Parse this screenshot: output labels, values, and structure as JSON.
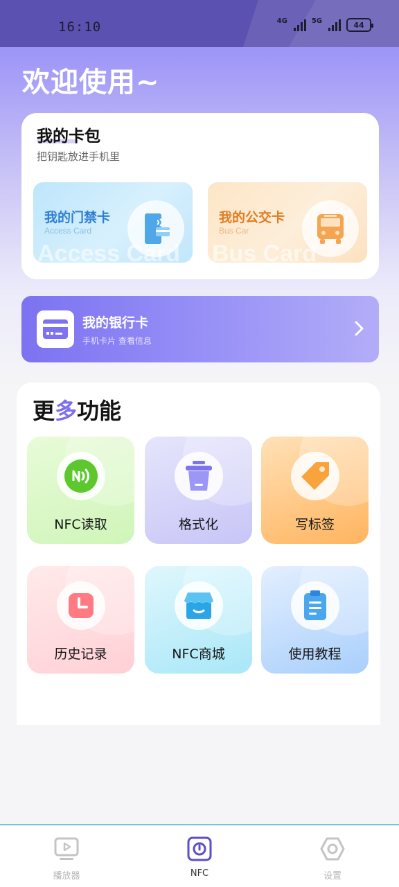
{
  "status_bar": {
    "time": "16:10",
    "network1": "4G",
    "network2": "5G",
    "battery": "44"
  },
  "header": {
    "welcome": "欢迎使用~"
  },
  "wallet": {
    "title": "我的卡包",
    "subtitle": "把钥匙放进手机里",
    "access_card": {
      "title": "我的门禁卡",
      "subtitle": "Access Card",
      "watermark": "Access Card"
    },
    "bus_card": {
      "title": "我的公交卡",
      "subtitle": "Bus Car",
      "watermark": "Bus Card"
    }
  },
  "bank_card": {
    "title": "我的银行卡",
    "subtitle": "手机卡片  查看信息"
  },
  "more_features": {
    "title_prefix": "更",
    "title_accent": "多",
    "title_suffix": "功能",
    "items": [
      {
        "label": "NFC读取",
        "icon": "nfc-icon"
      },
      {
        "label": "格式化",
        "icon": "trash-icon"
      },
      {
        "label": "写标签",
        "icon": "tag-icon"
      },
      {
        "label": "历史记录",
        "icon": "clock-icon"
      },
      {
        "label": "NFC商城",
        "icon": "store-icon"
      },
      {
        "label": "使用教程",
        "icon": "clipboard-icon"
      }
    ]
  },
  "tabbar": {
    "tabs": [
      {
        "label": "播放器",
        "icon": "player-icon",
        "active": false
      },
      {
        "label": "NFC",
        "icon": "nfc-tab-icon",
        "active": true
      },
      {
        "label": "设置",
        "icon": "settings-icon",
        "active": false
      }
    ]
  },
  "colors": {
    "accent": "#7b6ef2",
    "status_bar": "#5b51b0"
  }
}
